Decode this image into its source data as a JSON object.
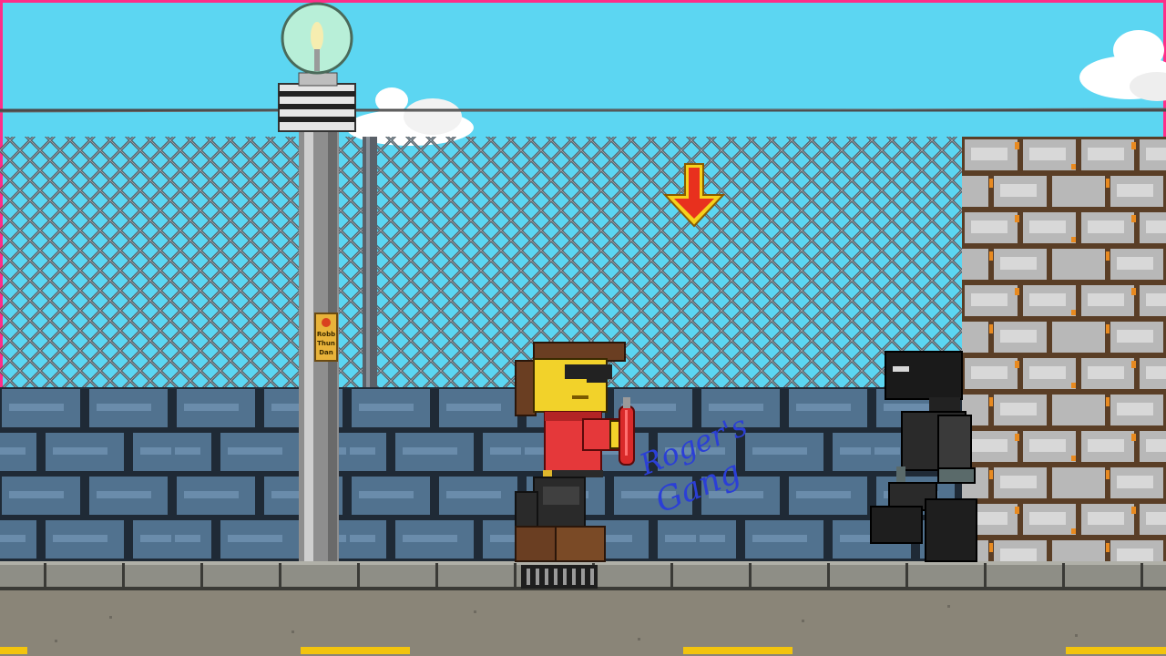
{
  "scene": {
    "sign": {
      "line1": "Robb",
      "line2": "Thun",
      "line3": "Dan"
    },
    "graffiti": {
      "line1": "Roger's",
      "line2": "Gang"
    },
    "colors": {
      "sky": "#5cd6f2",
      "fence": "#4a5560",
      "lower_wall": "#51728f",
      "brick_wall": "#b4b4b4",
      "sidewalk": "#8e8e86",
      "road": "#8a8578",
      "road_line": "#f2c40e",
      "frame_border": "#ff2e88"
    },
    "characters": {
      "player": {
        "name": "red-shirt-gangster",
        "holding": "fire-extinguisher"
      },
      "enemy": {
        "name": "black-ninja"
      }
    },
    "indicator": {
      "icon": "down-arrow-icon"
    }
  }
}
